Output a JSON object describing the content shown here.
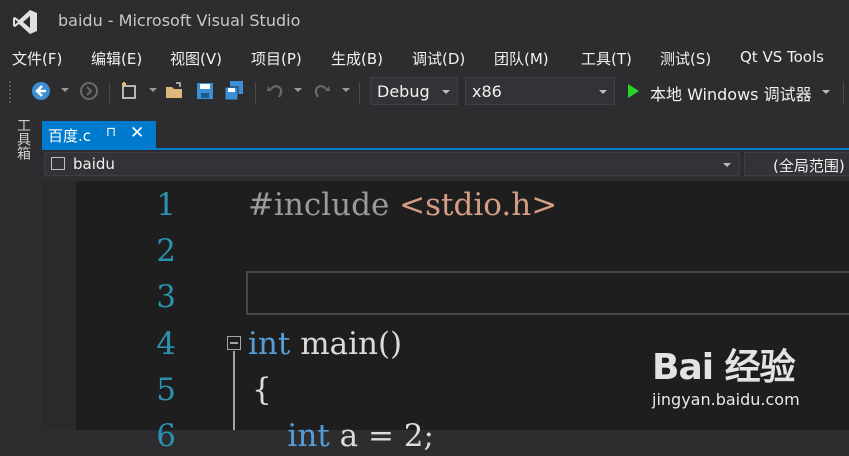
{
  "window": {
    "title": "baidu - Microsoft Visual Studio"
  },
  "menu": {
    "items": [
      "文件(F)",
      "编辑(E)",
      "视图(V)",
      "项目(P)",
      "生成(B)",
      "调试(D)",
      "团队(M)",
      "工具(T)",
      "测试(S)",
      "Qt VS Tools"
    ]
  },
  "toolbar": {
    "configuration": "Debug",
    "platform": "x86",
    "run_label": "本地 Windows 调试器"
  },
  "toolbox": {
    "label": "工具箱"
  },
  "document_tab": {
    "label": "百度.c",
    "pin_glyph": "⊓",
    "close_glyph": "✕"
  },
  "navigation": {
    "project": "baidu",
    "scope": "(全局范围)"
  },
  "editor": {
    "line_numbers": [
      "1",
      "2",
      "3",
      "4",
      "5",
      "6"
    ],
    "lines": [
      {
        "pre": "#include",
        "inc": " <stdio.h>",
        "kw": "",
        "rest": ""
      },
      {
        "pre": "",
        "inc": "",
        "kw": "",
        "rest": ""
      },
      {
        "pre": "",
        "inc": "",
        "kw": "",
        "rest": ""
      },
      {
        "pre": "",
        "inc": "",
        "kw": "int",
        "rest": " main()"
      },
      {
        "pre": "",
        "inc": "",
        "kw": "",
        "rest": "{"
      },
      {
        "pre": "",
        "inc": "",
        "kw": "    int",
        "rest": " a = 2;"
      }
    ]
  },
  "watermark": {
    "logo": "Bai 经验",
    "url": "jingyan.baidu.com"
  },
  "colors": {
    "accent": "#007acc",
    "line_number": "#2b91af",
    "keyword": "#569cd6",
    "include_path": "#d69d85",
    "run_green": "#26d526"
  }
}
